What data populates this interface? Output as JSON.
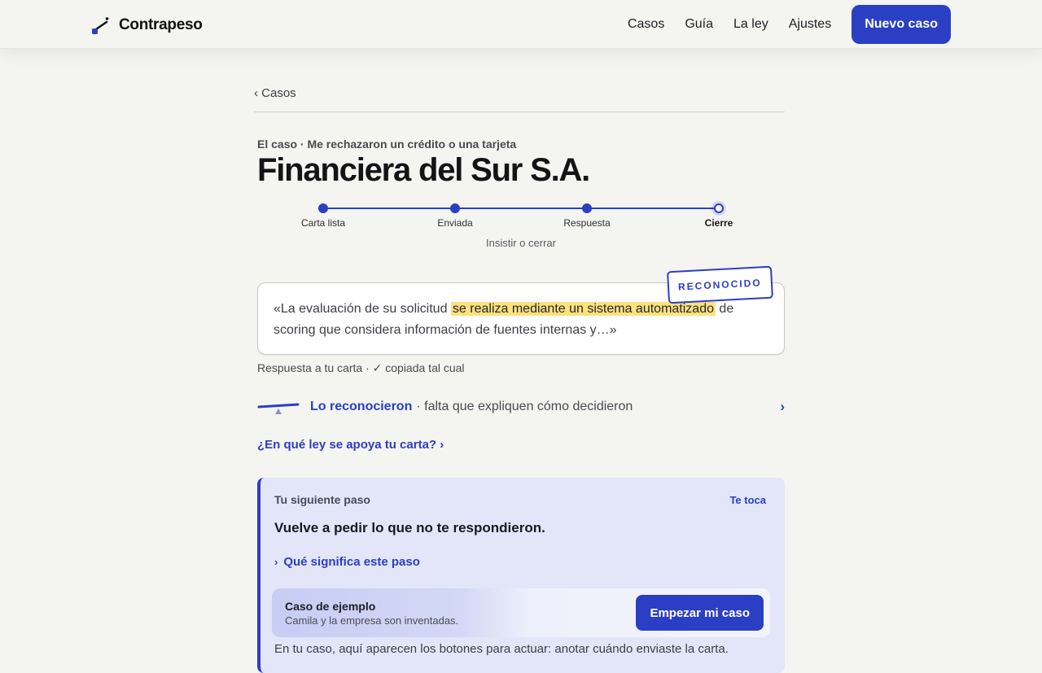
{
  "header": {
    "brand": "Contrapeso",
    "nav": [
      "Casos",
      "Guía",
      "La ley",
      "Ajustes"
    ],
    "cta": "Nuevo caso"
  },
  "page": {
    "back": "‹ Casos",
    "eyebrow": "El caso · Me rechazaron un crédito o una tarjeta",
    "title": "Financiera del Sur S.A."
  },
  "stepper": {
    "steps": [
      {
        "label": "Carta lista",
        "state": "done"
      },
      {
        "label": "Enviada",
        "state": "done"
      },
      {
        "label": "Respuesta",
        "state": "done"
      },
      {
        "label": "Cierre",
        "state": "current"
      }
    ],
    "sub": "Insistir o cerrar"
  },
  "quote": {
    "stamp": "RECONOCIDO",
    "before": "«La evaluación de su solicitud ",
    "highlight": "se realiza mediante un sistema automatizado",
    "after": " de scoring que considera información de fuentes internas y…»",
    "meta": "Respuesta a tu carta · ✓ copiada tal cual"
  },
  "finding": {
    "strong": "Lo reconocieron",
    "rest": "· falta que expliquen cómo decidieron",
    "chevron": "›"
  },
  "law_link": "¿En qué ley se apoya tu carta? ›",
  "next_step": {
    "eyebrow": "Tu siguiente paso",
    "badge": "Te toca",
    "title": "Vuelve a pedir lo que no te respondieron.",
    "more": "Qué significa este paso",
    "more_chevron": "›",
    "example": {
      "title": "Caso de ejemplo",
      "subtitle": "Camila y la empresa son inventadas.",
      "button": "Empezar mi caso"
    },
    "footer": "En tu caso, aquí aparecen los botones para actuar: anotar cuándo enviaste la carta."
  },
  "colors": {
    "accent": "#2b3fc4",
    "highlight": "#fce17e",
    "background": "#f4f4f1"
  }
}
